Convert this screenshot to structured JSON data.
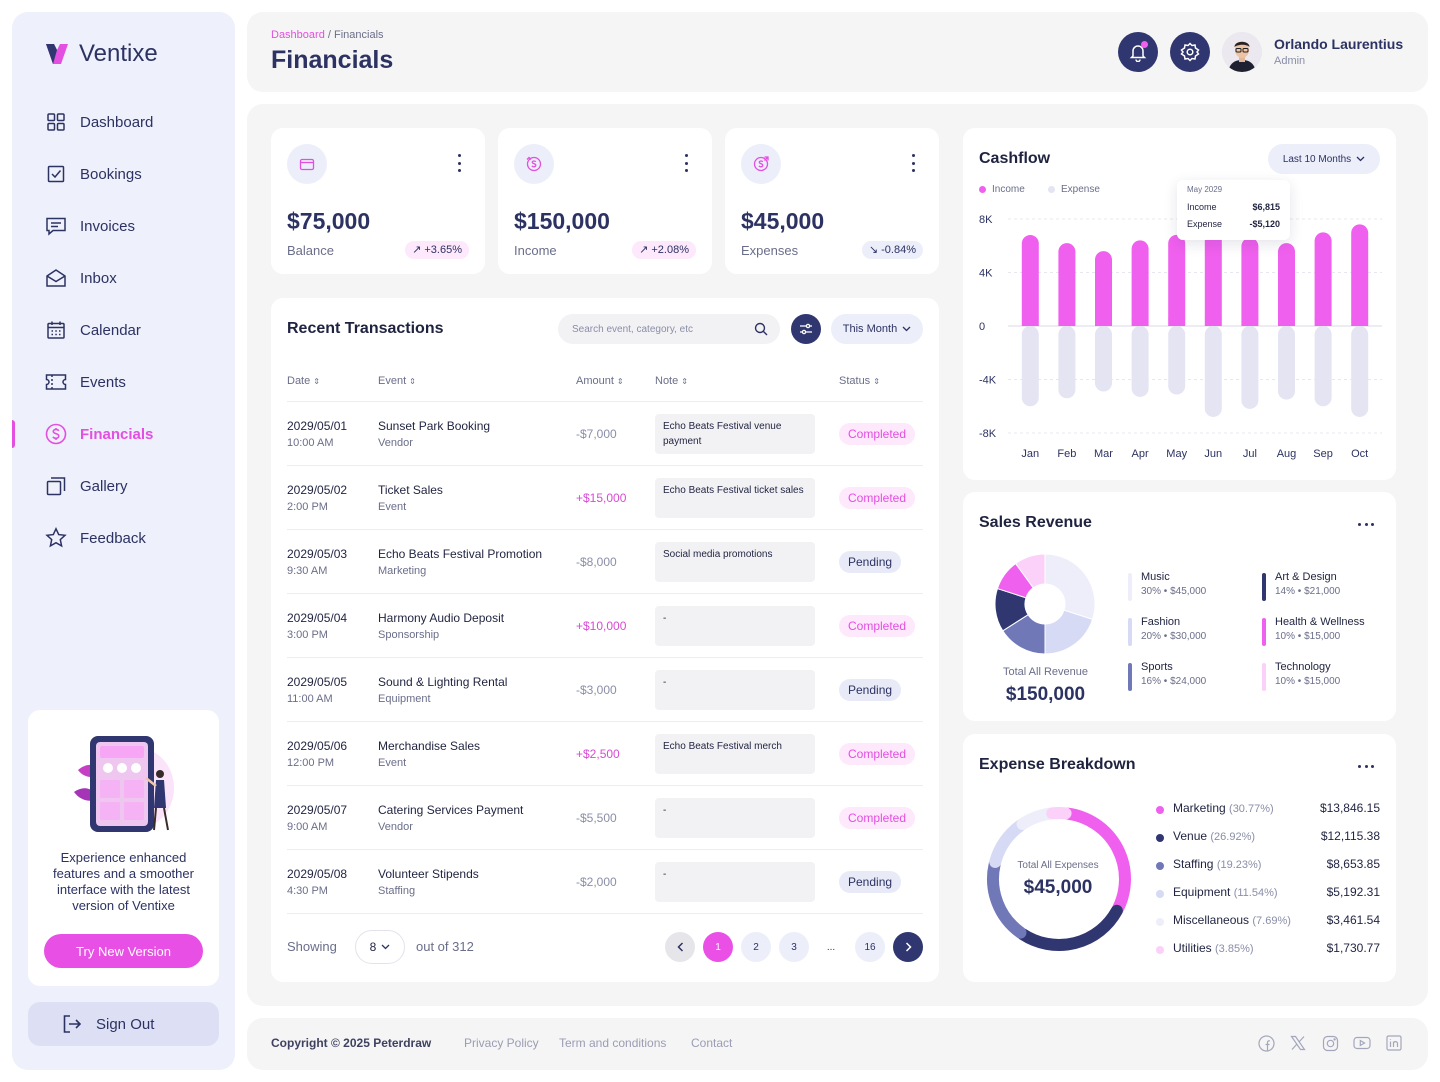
{
  "brand": {
    "name": "Ventixe",
    "accent": "#e34fe0",
    "navy": "#2f3670"
  },
  "sidebar": {
    "items": [
      {
        "label": "Dashboard",
        "icon": "grid-icon"
      },
      {
        "label": "Bookings",
        "icon": "checkbox-icon"
      },
      {
        "label": "Invoices",
        "icon": "invoice-icon"
      },
      {
        "label": "Inbox",
        "icon": "envelope-icon"
      },
      {
        "label": "Calendar",
        "icon": "calendar-icon"
      },
      {
        "label": "Events",
        "icon": "ticket-icon"
      },
      {
        "label": "Financials",
        "icon": "dollar-circle-icon",
        "active": true
      },
      {
        "label": "Gallery",
        "icon": "gallery-icon"
      },
      {
        "label": "Feedback",
        "icon": "star-icon"
      }
    ],
    "promo": {
      "text": "Experience enhanced features and a smoother interface with the latest version of Ventixe",
      "button": "Try New Version"
    },
    "signout": "Sign Out"
  },
  "header": {
    "breadcrumb_root": "Dashboard",
    "breadcrumb_sep": "/",
    "breadcrumb_current": "Financials",
    "title": "Financials",
    "user": {
      "name": "Orlando Laurentius",
      "role": "Admin"
    }
  },
  "stats": [
    {
      "value": "$75,000",
      "label": "Balance",
      "change": "+3.65%",
      "trend": "up",
      "icon": "wallet-icon"
    },
    {
      "value": "$150,000",
      "label": "Income",
      "change": "+2.08%",
      "trend": "up",
      "icon": "income-coin-icon"
    },
    {
      "value": "$45,000",
      "label": "Expenses",
      "change": "-0.84%",
      "trend": "down",
      "icon": "expense-coin-icon"
    }
  ],
  "transactions": {
    "title": "Recent Transactions",
    "search_placeholder": "Search event, category, etc",
    "period": "This Month",
    "columns": [
      "Date",
      "Event",
      "Amount",
      "Note",
      "Status"
    ],
    "rows": [
      {
        "date": "2029/05/01",
        "time": "10:00 AM",
        "event": "Sunset Park Booking",
        "category": "Vendor",
        "amount": "-$7,000",
        "note": "Echo Beats Festival venue payment",
        "status": "Completed"
      },
      {
        "date": "2029/05/02",
        "time": "2:00 PM",
        "event": "Ticket Sales",
        "category": "Event",
        "amount": "+$15,000",
        "note": "Echo Beats Festival ticket sales",
        "status": "Completed"
      },
      {
        "date": "2029/05/03",
        "time": "9:30 AM",
        "event": "Echo Beats Festival Promotion",
        "category": "Marketing",
        "amount": "-$8,000",
        "note": "Social media promotions",
        "status": "Pending"
      },
      {
        "date": "2029/05/04",
        "time": "3:00 PM",
        "event": "Harmony Audio Deposit",
        "category": "Sponsorship",
        "amount": "+$10,000",
        "note": "-",
        "status": "Completed"
      },
      {
        "date": "2029/05/05",
        "time": "11:00 AM",
        "event": "Sound & Lighting Rental",
        "category": "Equipment",
        "amount": "-$3,000",
        "note": "-",
        "status": "Pending"
      },
      {
        "date": "2029/05/06",
        "time": "12:00 PM",
        "event": "Merchandise Sales",
        "category": "Event",
        "amount": "+$2,500",
        "note": "Echo Beats Festival merch",
        "status": "Completed"
      },
      {
        "date": "2029/05/07",
        "time": "9:00 AM",
        "event": "Catering Services Payment",
        "category": "Vendor",
        "amount": "-$5,500",
        "note": "-",
        "status": "Completed"
      },
      {
        "date": "2029/05/08",
        "time": "4:30 PM",
        "event": "Volunteer Stipends",
        "category": "Staffing",
        "amount": "-$2,000",
        "note": "-",
        "status": "Pending"
      }
    ],
    "showing_label": "Showing",
    "per_page": "8",
    "total_label": "out of 312",
    "pages": [
      "1",
      "2",
      "3",
      "...",
      "16"
    ],
    "current_page": "1"
  },
  "cashflow": {
    "title": "Cashflow",
    "range": "Last 10 Months",
    "legend": [
      "Income",
      "Expense"
    ],
    "tooltip": {
      "month": "May 2029",
      "income_label": "Income",
      "income": "$6,815",
      "expense_label": "Expense",
      "expense": "-$5,120"
    }
  },
  "chart_data": {
    "type": "bar",
    "title": "Cashflow",
    "categories": [
      "Jan",
      "Feb",
      "Mar",
      "Apr",
      "May",
      "Jun",
      "Jul",
      "Aug",
      "Sep",
      "Oct"
    ],
    "series": [
      {
        "name": "Income",
        "color": "#f060ee",
        "values": [
          6800,
          6200,
          5600,
          6400,
          6815,
          7000,
          6600,
          6200,
          7000,
          7600
        ]
      },
      {
        "name": "Expense",
        "color": "#e4e4f2",
        "values": [
          -6000,
          -5400,
          -4900,
          -5300,
          -5120,
          -6800,
          -6200,
          -5500,
          -6000,
          -6800
        ]
      }
    ],
    "ylim": [
      -8000,
      8000
    ],
    "yticks": [
      "8K",
      "4K",
      "0",
      "-4K",
      "-8K"
    ],
    "ytick_values": [
      8000,
      4000,
      0,
      -4000,
      -8000
    ],
    "grid": true,
    "legend": "top-left"
  },
  "sales_revenue": {
    "title": "Sales Revenue",
    "total_label": "Total All Revenue",
    "total": "$150,000",
    "items": [
      {
        "name": "Music",
        "detail": "30% • $45,000",
        "pct": 30,
        "color": "#eeeefa"
      },
      {
        "name": "Art & Design",
        "detail": "14% • $21,000",
        "pct": 14,
        "color": "#2f3670"
      },
      {
        "name": "Fashion",
        "detail": "20% • $30,000",
        "pct": 20,
        "color": "#d6daf4"
      },
      {
        "name": "Health & Wellness",
        "detail": "10% • $15,000",
        "pct": 10,
        "color": "#f060ee"
      },
      {
        "name": "Sports",
        "detail": "16% • $24,000",
        "pct": 16,
        "color": "#7078b8"
      },
      {
        "name": "Technology",
        "detail": "10% • $15,000",
        "pct": 10,
        "color": "#fbd1fa"
      }
    ]
  },
  "expense_breakdown": {
    "title": "Expense Breakdown",
    "total_label": "Total All Expenses",
    "total": "$45,000",
    "items": [
      {
        "name": "Marketing",
        "pct_label": "(30.77%)",
        "pct": 30.77,
        "value": "$13,846.15",
        "color": "#f060ee"
      },
      {
        "name": "Venue",
        "pct_label": "(26.92%)",
        "pct": 26.92,
        "value": "$12,115.38",
        "color": "#2f3670"
      },
      {
        "name": "Staffing",
        "pct_label": "(19.23%)",
        "pct": 19.23,
        "value": "$8,653.85",
        "color": "#7078b8"
      },
      {
        "name": "Equipment",
        "pct_label": "(11.54%)",
        "pct": 11.54,
        "value": "$5,192.31",
        "color": "#d6daf4"
      },
      {
        "name": "Miscellaneous",
        "pct_label": "(7.69%)",
        "pct": 7.69,
        "value": "$3,461.54",
        "color": "#eeeefa"
      },
      {
        "name": "Utilities",
        "pct_label": "(3.85%)",
        "pct": 3.85,
        "value": "$1,730.77",
        "color": "#fbd1fa"
      }
    ]
  },
  "footer": {
    "copyright": "Copyright © 2025 Peterdraw",
    "links": [
      "Privacy Policy",
      "Term and conditions",
      "Contact"
    ],
    "social": [
      "facebook-icon",
      "x-icon",
      "instagram-icon",
      "youtube-icon",
      "linkedin-icon"
    ]
  }
}
